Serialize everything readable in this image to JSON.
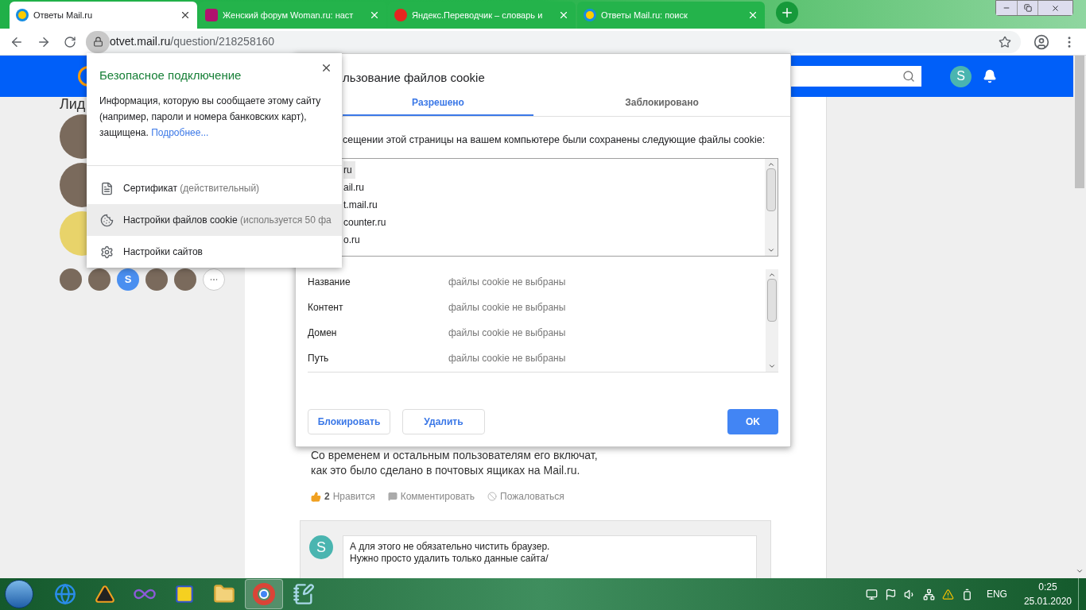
{
  "browser": {
    "tabs": [
      {
        "title": "Ответы Mail.ru",
        "kind": "question",
        "selected": true
      },
      {
        "title": "Женский форум Woman.ru: наст",
        "kind": "woman",
        "selected": false
      },
      {
        "title": "Яндекс.Переводчик – словарь и",
        "kind": "translate",
        "selected": false
      },
      {
        "title": "Ответы Mail.ru: поиск",
        "kind": "question",
        "selected": false
      }
    ],
    "address": {
      "host": "otvet.mail.ru",
      "path": "/question/218258160"
    }
  },
  "page": {
    "sidebar_heading": "Лид",
    "leader_avatars": [
      {
        "kind": "photo"
      },
      {
        "kind": "photo"
      },
      {
        "kind": "drawing"
      }
    ],
    "small_avatars": [
      {
        "kind": "photo"
      },
      {
        "kind": "photo"
      },
      {
        "kind": "letter",
        "letter": "S"
      },
      {
        "kind": "photo"
      },
      {
        "kind": "photo"
      }
    ],
    "user_initial": "S",
    "answer_lines": [
      "Со временем и остальным пользователям его включат,",
      "как это было сделано в почтовых ящиках на Mail.ru."
    ],
    "actions": {
      "like_count": "2",
      "like": "Нравится",
      "comment": "Комментировать",
      "report": "Пожаловаться"
    },
    "comment": {
      "initial": "S",
      "lines": [
        "А для этого не обязательно чистить браузер.",
        "Нужно просто удалить только данные сайта/"
      ]
    }
  },
  "security_popup": {
    "title": "Безопасное подключение",
    "text": "Информация, которую вы сообщаете этому сайту (например, пароли и номера банковских карт), защищена.",
    "link": "Подробнее...",
    "items": [
      {
        "kind": "certificate",
        "label": "Сертификат",
        "note": "(действительный)",
        "highlighted": false
      },
      {
        "kind": "cookie",
        "label": "Настройки файлов cookie",
        "note": "(используется 50 фа",
        "highlighted": true
      },
      {
        "kind": "settings",
        "label": "Настройки сайтов",
        "highlighted": false
      }
    ]
  },
  "cookie_dialog": {
    "title": "льзование файлов cookie",
    "tabs": [
      {
        "label": "Разрешено",
        "selected": true
      },
      {
        "label": "Заблокировано",
        "selected": false
      }
    ],
    "description": "сещении этой страницы на вашем компьютере были сохранены следующие файлы cookie:",
    "cookies": [
      {
        "name": "ru",
        "selected": true
      },
      {
        "name": "ail.ru",
        "selected": false
      },
      {
        "name": "t.mail.ru",
        "selected": false
      },
      {
        "name": "counter.ru",
        "selected": false
      },
      {
        "name": "o.ru",
        "selected": false
      }
    ],
    "details": [
      {
        "label": "Название",
        "value": "файлы cookie не выбраны"
      },
      {
        "label": "Контент",
        "value": "файлы cookie не выбраны"
      },
      {
        "label": "Домен",
        "value": "файлы cookie не выбраны"
      },
      {
        "label": "Путь",
        "value": "файлы cookie не выбраны"
      }
    ],
    "buttons": [
      {
        "label": "Блокировать",
        "kind": "secondary"
      },
      {
        "label": "Удалить",
        "kind": "secondary"
      },
      {
        "label": "OK",
        "kind": "primary"
      }
    ]
  },
  "taskbar": {
    "apps": [
      {
        "kind": "globe",
        "selected": false
      },
      {
        "kind": "triangle",
        "selected": false
      },
      {
        "kind": "infinity",
        "selected": false
      },
      {
        "kind": "square",
        "selected": false
      },
      {
        "kind": "folder",
        "selected": false
      },
      {
        "kind": "circle",
        "selected": true
      },
      {
        "kind": "notepad",
        "selected": false
      }
    ],
    "language": "ENG",
    "time": "0:25",
    "date": "25.01.2020"
  }
}
